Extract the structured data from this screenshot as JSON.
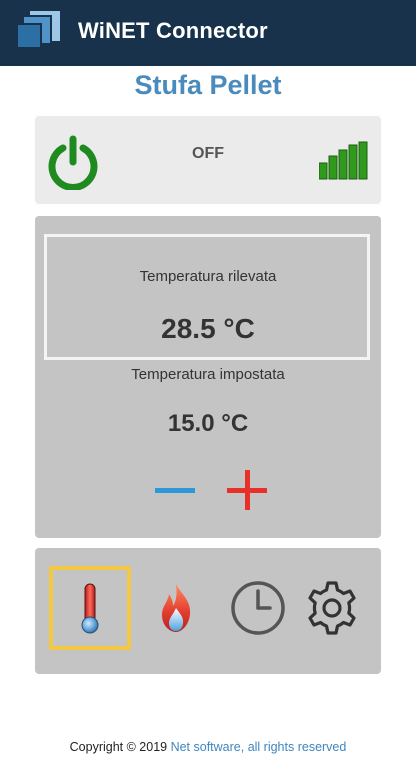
{
  "app": {
    "title": "WiNET Connector"
  },
  "page": {
    "title": "Stufa Pellet"
  },
  "status": {
    "power_icon": "power-icon",
    "state": "OFF",
    "signal_icon": "signal-strength-icon"
  },
  "temperature": {
    "measured_label": "Temperatura rilevata",
    "measured_value": "28.5 °C",
    "set_label": "Temperatura impostata",
    "set_value": "15.0 °C",
    "decrease_icon": "minus-icon",
    "increase_icon": "plus-icon"
  },
  "nav": {
    "items": [
      {
        "icon": "thermometer-icon",
        "active": true
      },
      {
        "icon": "flame-icon",
        "active": false
      },
      {
        "icon": "clock-icon",
        "active": false
      },
      {
        "icon": "gear-icon",
        "active": false
      }
    ]
  },
  "footer": {
    "copyright": "Copyright © 2019 ",
    "link_text": "Net software, all rights reserved"
  },
  "colors": {
    "header_bg": "#17324a",
    "title_blue": "#4a8bbd",
    "power_green": "#1f8a1f",
    "signal_green": "#2f9a1c",
    "minus_blue": "#2c98d8",
    "plus_red": "#e8302a",
    "active_border": "#f5c842",
    "panel_gray": "#c4c4c4"
  }
}
